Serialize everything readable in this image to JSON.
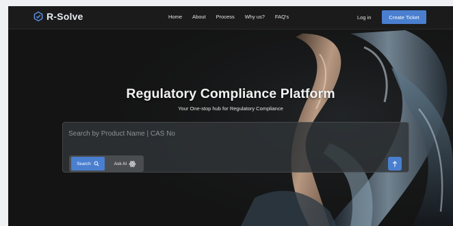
{
  "brand": {
    "name": "R-Solve",
    "logo_icon": "hexagon-check-icon",
    "accent": "#4a7fd0"
  },
  "nav": {
    "items": [
      {
        "label": "Home"
      },
      {
        "label": "About"
      },
      {
        "label": "Process"
      },
      {
        "label": "Why us?"
      },
      {
        "label": "FAQ's"
      }
    ],
    "login_label": "Log in",
    "cta_label": "Create Ticket"
  },
  "hero": {
    "title": "Regulatory Compliance Platform",
    "subtitle": "Your One-stop hub for Regulatory Compliance"
  },
  "search": {
    "placeholder": "Search by Product Name | CAS No",
    "value": "",
    "modes": [
      {
        "label": "Search",
        "icon": "search-icon",
        "active": true
      },
      {
        "label": "Ask AI",
        "icon": "ai-atom-icon",
        "active": false
      }
    ],
    "send_icon": "arrow-up-icon"
  },
  "colors": {
    "background": "#121212",
    "accent": "#4a7fd0",
    "nav_bg": "#1b1b1b"
  }
}
